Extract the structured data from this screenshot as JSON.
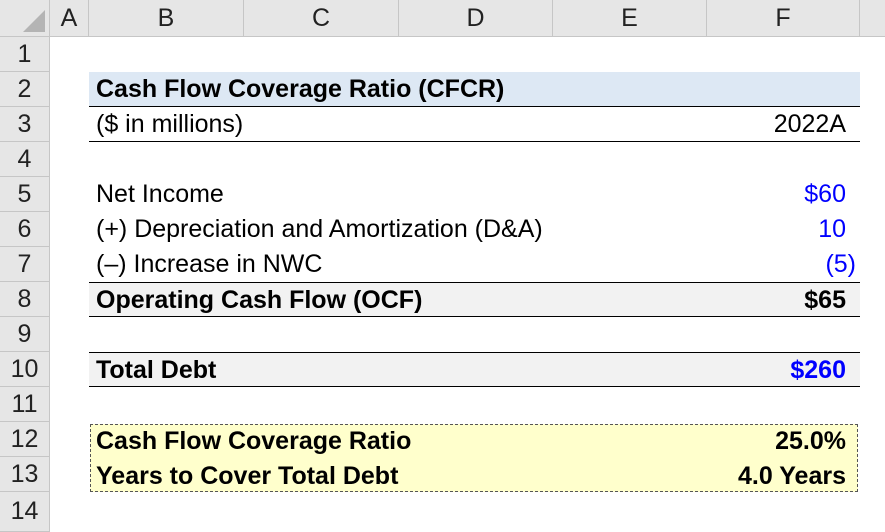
{
  "columns": [
    "A",
    "B",
    "C",
    "D",
    "E",
    "F"
  ],
  "rows": [
    "1",
    "2",
    "3",
    "4",
    "5",
    "6",
    "7",
    "8",
    "9",
    "10",
    "11",
    "12",
    "13",
    "14"
  ],
  "table": {
    "title": "Cash Flow Coverage Ratio (CFCR)",
    "units_label": "($ in millions)",
    "period": "2022A",
    "net_income_label": "Net Income",
    "net_income_value": "$60",
    "da_label": "(+) Depreciation and Amortization (D&A)",
    "da_value": "10",
    "nwc_label": "(–) Increase in NWC",
    "nwc_value": "(5)",
    "ocf_label": "Operating Cash Flow (OCF)",
    "ocf_value": "$65",
    "debt_label": "Total Debt",
    "debt_value": "$260",
    "cfcr_label": "Cash Flow Coverage Ratio",
    "cfcr_value": "25.0%",
    "years_label": "Years to Cover Total Debt",
    "years_value": "4.0 Years"
  },
  "colors": {
    "input_blue": "#0000ff",
    "title_fill": "#dde8f4",
    "output_fill": "#ffffcc",
    "header_fill": "#e6e6e6"
  }
}
